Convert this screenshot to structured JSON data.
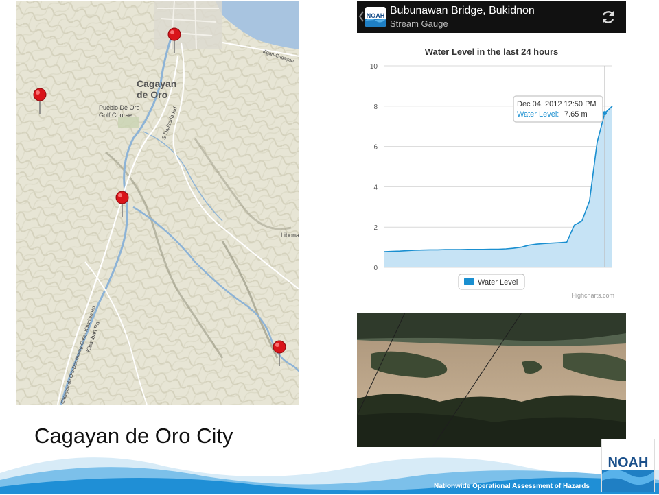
{
  "caption": "Cagayan de Oro City",
  "map": {
    "labels": {
      "city": [
        "Cagayan",
        "de Oro"
      ],
      "golf": [
        "Pueblo De Oro",
        "Golf Course"
      ],
      "libona": "Libona",
      "road_divisoria": "S Divisoria Rd",
      "road_kibanban": "Kibanban Rd",
      "road_camp": "Cagayan de Oro-Dominorog-Camp Kibaritan Rd",
      "road_iligan": "Iligan-Cagayan"
    },
    "pin_color": "#d9141a"
  },
  "app": {
    "title": "Bubunawan Bridge, Bukidnon",
    "subtitle": "Stream Gauge",
    "back_icon": "chevron-left-icon",
    "refresh_icon": "refresh-icon",
    "logo_text": "NOAH"
  },
  "chart_data": {
    "type": "area",
    "title": "Water Level in the last 24 hours",
    "ylim": [
      0,
      10
    ],
    "yticks": [
      "0",
      "2",
      "4",
      "6",
      "8",
      "10"
    ],
    "series": [
      {
        "name": "Water Level",
        "color": "#1a8fd0",
        "fill": "#c6e3f5",
        "values": [
          0.78,
          0.8,
          0.81,
          0.83,
          0.85,
          0.86,
          0.87,
          0.87,
          0.88,
          0.88,
          0.88,
          0.89,
          0.89,
          0.89,
          0.9,
          0.9,
          0.92,
          0.95,
          1.0,
          1.1,
          1.15,
          1.18,
          1.2,
          1.22,
          1.25,
          2.1,
          2.3,
          3.3,
          6.2,
          7.65,
          8.0
        ]
      }
    ],
    "tooltip": {
      "date": "Dec 04, 2012 12:50 PM",
      "label": "Water Level:",
      "value": "7.65 m"
    },
    "legend": "bottom",
    "credit": "Highcharts.com",
    "grid": true
  },
  "footer": {
    "text": "Nationwide Operational Assessment of Hazards",
    "logo_text": "NOAH",
    "wave_colors": [
      "#1f8fd6",
      "#7cc0ea",
      "#d7ebf7"
    ]
  }
}
